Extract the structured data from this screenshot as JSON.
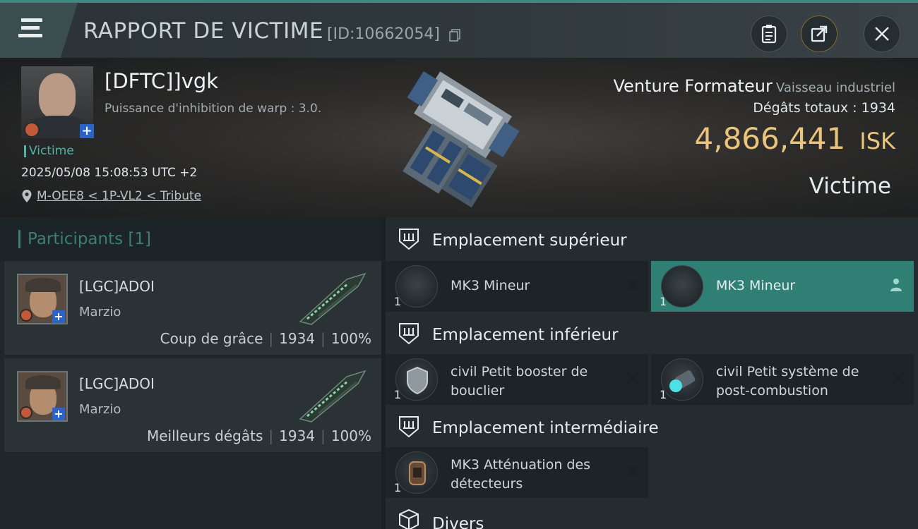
{
  "header": {
    "title": "RAPPORT DE VICTIME",
    "id_text": "[ID:10662054]",
    "icons": [
      "menu-icon",
      "copy-icon",
      "clipboard-icon",
      "share-icon",
      "close-icon"
    ]
  },
  "victim": {
    "name": "[DFTC]]vgk",
    "warp_line": "Puissance d'inhibition de warp : 3.0.",
    "tag": "Victime",
    "datetime": "2025/05/08 15:08:53 UTC +2",
    "location": "M-OEE8 < 1P-VL2 < Tribute",
    "ship_name": "Venture Formateur",
    "ship_class": "Vaisseau industriel",
    "damage_label": "Dégâts totaux :",
    "damage_value": "1934",
    "isk_value": "4,866,441",
    "isk_unit": "ISK",
    "role": "Victime"
  },
  "participants": {
    "title": "Participants",
    "count": "[1]",
    "cards": [
      {
        "name": "[LGC]ADOI",
        "character": "Marzio",
        "label": "Coup de grâce",
        "damage": "1934",
        "percent": "100%"
      },
      {
        "name": "[LGC]ADOI",
        "character": "Marzio",
        "label": "Meilleurs dégâts",
        "damage": "1934",
        "percent": "100%"
      }
    ]
  },
  "slots": {
    "high": {
      "label": "Emplacement supérieur",
      "items": [
        {
          "name": "MK3 Mineur",
          "qty": "1",
          "selected": false
        },
        {
          "name": "MK3 Mineur",
          "qty": "1",
          "selected": true
        }
      ]
    },
    "low": {
      "label": "Emplacement inférieur",
      "items": [
        {
          "name": "civil Petit booster de bouclier",
          "qty": "1"
        },
        {
          "name": "civil Petit système de post-combustion",
          "qty": "1"
        }
      ]
    },
    "mid": {
      "label": "Emplacement intermédiaire",
      "items": [
        {
          "name": "MK3 Atténuation des détecteurs",
          "qty": "1"
        }
      ]
    },
    "misc": {
      "label": "Divers"
    }
  },
  "colors": {
    "accent": "#3e8a83",
    "isk": "#e9c47a",
    "selected_slot": "#2f7f75"
  }
}
